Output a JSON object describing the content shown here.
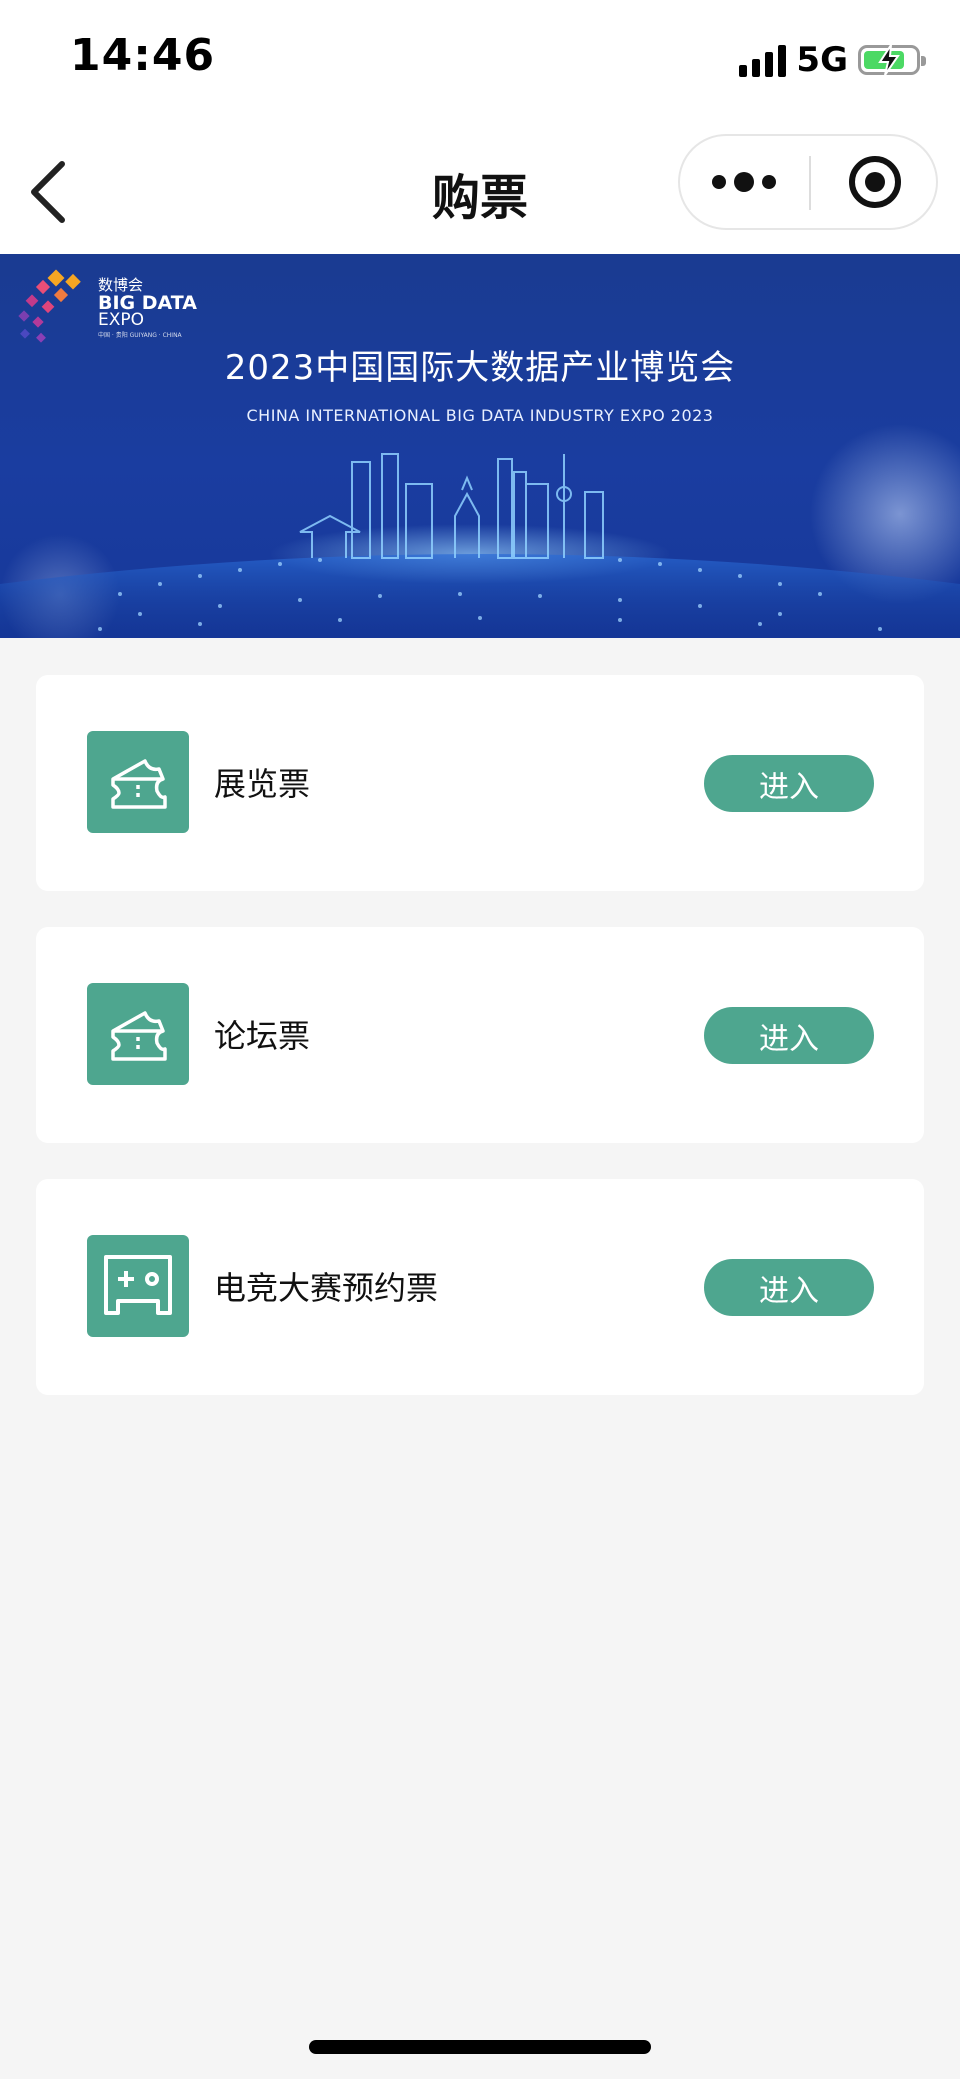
{
  "status_bar": {
    "time": "14:46",
    "network": "5G"
  },
  "nav": {
    "title": "购票"
  },
  "banner": {
    "logo_cn": "数博会",
    "logo_en_line1": "BIG DATA",
    "logo_en_line2": "EXPO",
    "logo_small": "中国 · 贵阳   GUIYANG · CHINA",
    "title": "2023中国国际大数据产业博览会",
    "subtitle": "CHINA INTERNATIONAL BIG DATA INDUSTRY EXPO 2023"
  },
  "tickets": [
    {
      "label": "展览票",
      "button": "进入",
      "icon": "ticket-icon"
    },
    {
      "label": "论坛票",
      "button": "进入",
      "icon": "ticket-icon"
    },
    {
      "label": "电竞大赛预约票",
      "button": "进入",
      "icon": "gamepad-icon"
    }
  ],
  "colors": {
    "accent": "#4ea68f",
    "banner_blue": "#1a3b91",
    "background": "#f5f5f5"
  }
}
